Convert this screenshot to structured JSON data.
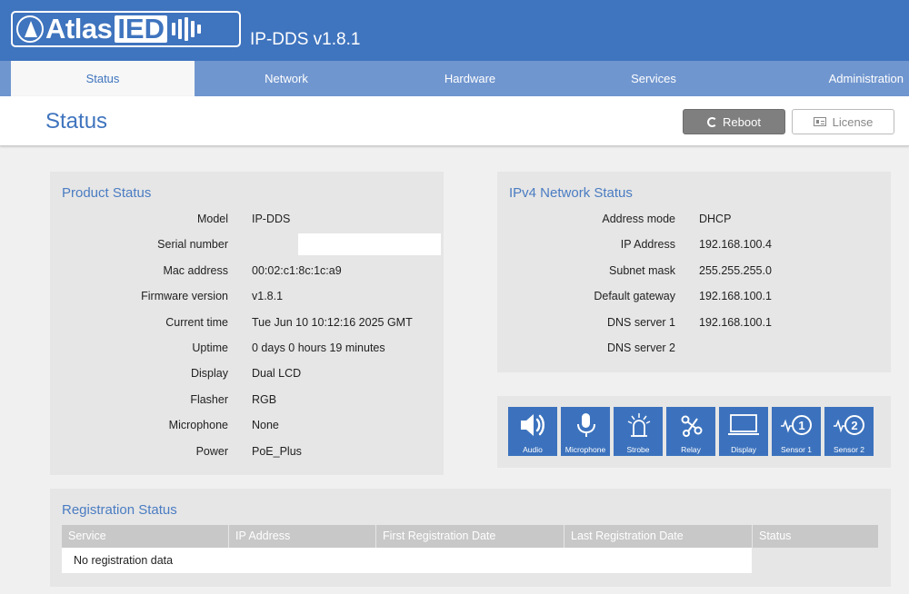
{
  "app": {
    "logo_atlas": "Atlas",
    "logo_ied": "IED",
    "title": "IP-DDS v1.8.1"
  },
  "tabs": [
    {
      "label": "Status",
      "active": true
    },
    {
      "label": "Network",
      "active": false
    },
    {
      "label": "Hardware",
      "active": false
    },
    {
      "label": "Services",
      "active": false
    },
    {
      "label": "Administration",
      "active": false
    }
  ],
  "page": {
    "title": "Status",
    "reboot_label": "Reboot",
    "license_label": "License"
  },
  "product_status": {
    "title": "Product Status",
    "rows": [
      {
        "label": "Model",
        "value": "IP-DDS"
      },
      {
        "label": "Serial number",
        "value": ""
      },
      {
        "label": "Mac address",
        "value": "00:02:c1:8c:1c:a9"
      },
      {
        "label": "Firmware version",
        "value": "v1.8.1"
      },
      {
        "label": "Current time",
        "value": "Tue Jun 10 10:12:16 2025 GMT"
      },
      {
        "label": "Uptime",
        "value": "0 days 0 hours 19 minutes"
      },
      {
        "label": "Display",
        "value": "Dual LCD"
      },
      {
        "label": "Flasher",
        "value": "RGB"
      },
      {
        "label": "Microphone",
        "value": "None"
      },
      {
        "label": "Power",
        "value": "PoE_Plus"
      }
    ]
  },
  "network_status": {
    "title": "IPv4 Network Status",
    "rows": [
      {
        "label": "Address mode",
        "value": "DHCP"
      },
      {
        "label": "IP Address",
        "value": "192.168.100.4"
      },
      {
        "label": "Subnet mask",
        "value": "255.255.255.0"
      },
      {
        "label": "Default gateway",
        "value": "192.168.100.1"
      },
      {
        "label": "DNS server 1",
        "value": "192.168.100.1"
      },
      {
        "label": "DNS server 2",
        "value": ""
      }
    ]
  },
  "features": [
    {
      "label": "Audio",
      "icon": "speaker-icon"
    },
    {
      "label": "Microphone",
      "icon": "microphone-icon"
    },
    {
      "label": "Strobe",
      "icon": "strobe-icon"
    },
    {
      "label": "Relay",
      "icon": "relay-icon"
    },
    {
      "label": "Display",
      "icon": "display-icon"
    },
    {
      "label": "Sensor 1",
      "icon": "sensor-1-icon",
      "num": "1"
    },
    {
      "label": "Sensor 2",
      "icon": "sensor-2-icon",
      "num": "2"
    }
  ],
  "registration": {
    "title": "Registration Status",
    "columns": [
      "Service",
      "IP Address",
      "First Registration Date",
      "Last Registration Date",
      "Status"
    ],
    "empty_text": "No registration data"
  },
  "colors": {
    "brand_blue": "#3f74be",
    "tab_bar": "#7096cf",
    "tile_blue": "#3c72bd"
  }
}
